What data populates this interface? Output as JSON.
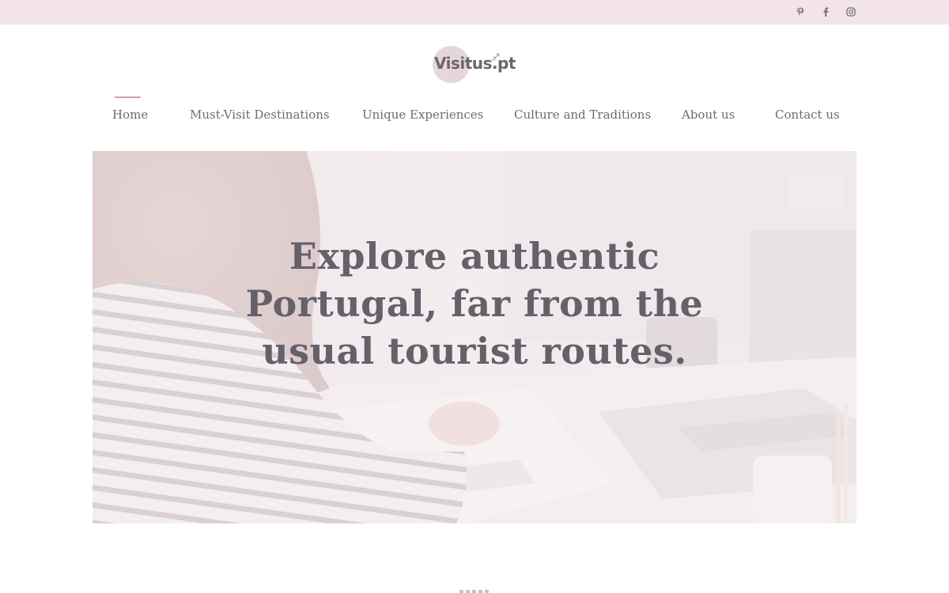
{
  "social": [
    {
      "icon": "pinterest-icon",
      "label": "Pinterest"
    },
    {
      "icon": "facebook-icon",
      "label": "Facebook"
    },
    {
      "icon": "instagram-icon",
      "label": "Instagram"
    }
  ],
  "logo": {
    "text": "Visitus.pt"
  },
  "nav": {
    "items": [
      {
        "label": "Home",
        "active": true
      },
      {
        "label": "Must-Visit Destinations",
        "active": false
      },
      {
        "label": "Unique Experiences",
        "active": false
      },
      {
        "label": "Culture and Traditions",
        "active": false
      },
      {
        "label": "About us",
        "active": false
      },
      {
        "label": "Contact us",
        "active": false
      }
    ]
  },
  "hero": {
    "title_line1": "Explore authentic",
    "title_line2": "Portugal, far from the",
    "title_line3": "usual tourist routes.",
    "image": "woman-writing-notebook-at-desk-photo"
  },
  "colors": {
    "topbar": "#f3e4e7",
    "accent": "#c9a4ad",
    "text": "#6f6a72",
    "logo_circle": "#e6d6da"
  }
}
